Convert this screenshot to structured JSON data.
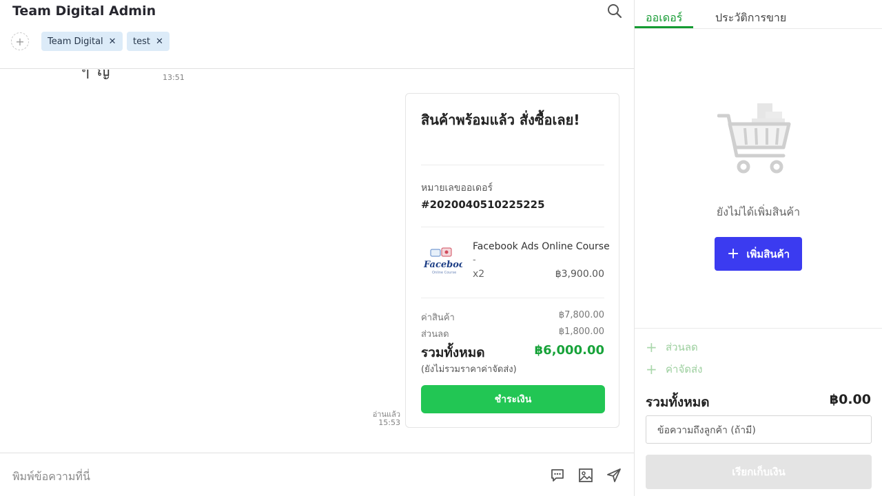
{
  "header": {
    "title": "Team Digital Admin",
    "tags": [
      {
        "label": "Team Digital",
        "remove": "✕"
      },
      {
        "label": "test",
        "remove": "✕"
      }
    ],
    "add_tag_symbol": "+"
  },
  "messages": {
    "partial_text": "ๆ ญ",
    "first_time": "13:51",
    "read_status": "อ่านแล้ว",
    "second_time": "15:53"
  },
  "order_card": {
    "title": "สินค้าพร้อมแล้ว สั่งซื้อเลย!",
    "order_no_label": "หมายเลขออเดอร์",
    "order_no": "#2020040510225225",
    "product": {
      "name": "Facebook Ads Online Course",
      "variant": "-",
      "qty": "x2",
      "price": "฿3,900.00",
      "thumb_text": "Facebook",
      "thumb_subtext": "Online Course"
    },
    "subtotal_label": "ค่าสินค้า",
    "subtotal": "฿7,800.00",
    "discount_label": "ส่วนลด",
    "discount": "฿1,800.00",
    "total_label": "รวมทั้งหมด",
    "total": "฿6,000.00",
    "total_note": "(ยังไม่รวมราคาค่าจัดส่ง)",
    "pay_label": "ชำระเงิน"
  },
  "chat_input": {
    "placeholder": "พิมพ์ข้อความที่นี่",
    "icons": [
      "quick-reply-icon",
      "image-icon",
      "send-icon"
    ]
  },
  "side_panel": {
    "tabs": [
      {
        "label": "ออเดอร์",
        "active": true
      },
      {
        "label": "ประวัติการขาย",
        "active": false
      }
    ],
    "empty_text": "ยังไม่ได้เพิ่มสินค้า",
    "add_product_label": "เพิ่มสินค้า",
    "discount_label": "ส่วนลด",
    "shipping_label": "ค่าจัดส่ง",
    "total_label": "รวมทั้งหมด",
    "total_value": "฿0.00",
    "note_placeholder": "ข้อความถึงลูกค้า (ถ้ามี)",
    "collect_label": "เรียกเก็บเงิน"
  },
  "colors": {
    "accent_green": "#149b32",
    "pay_green": "#22c654",
    "total_green": "#18a33a",
    "primary_blue": "#3b3bf0",
    "tag_bg": "#dcebf8"
  }
}
